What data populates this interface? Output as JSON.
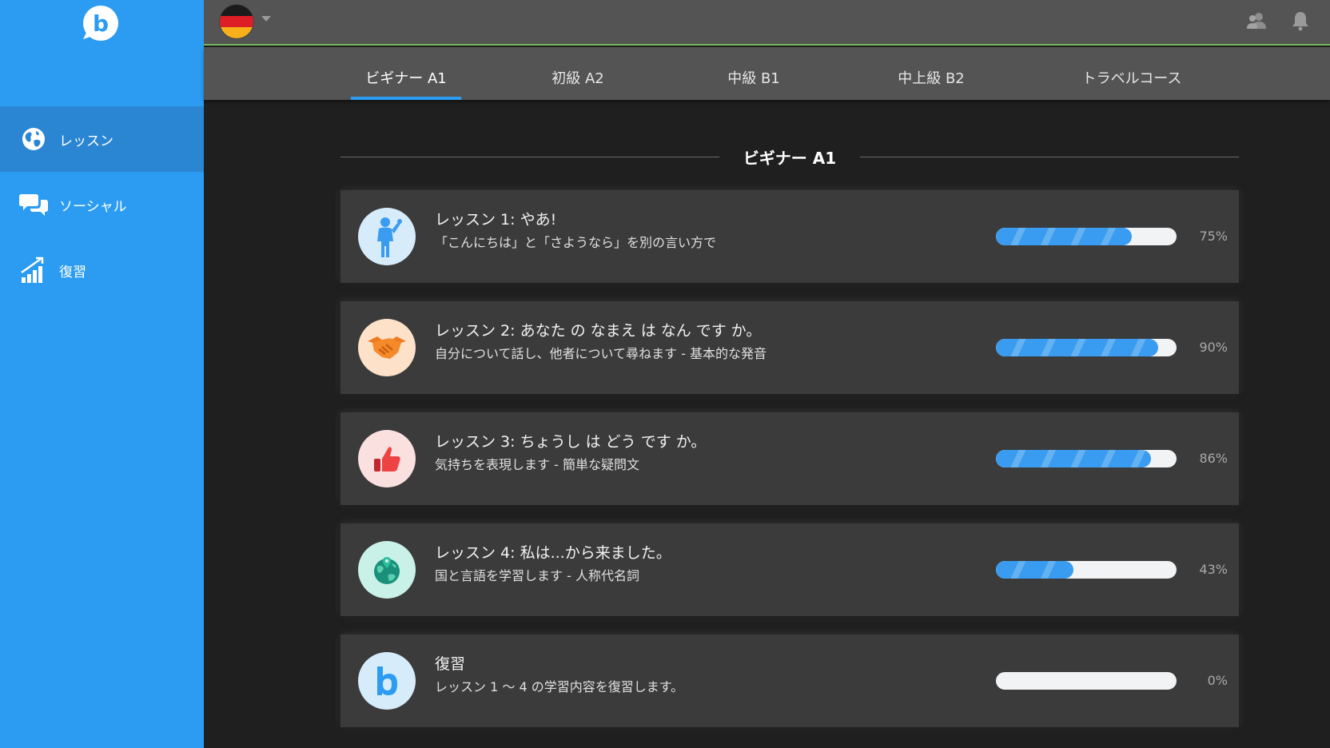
{
  "sidebar": {
    "logo_letter": "b",
    "items": [
      {
        "label": "レッスン",
        "icon": "globe-icon",
        "active": true
      },
      {
        "label": "ソーシャル",
        "icon": "chat-icon",
        "active": false
      },
      {
        "label": "復習",
        "icon": "chart-icon",
        "active": false
      }
    ]
  },
  "topbar": {
    "language_flag": "germany-flag-icon",
    "icons": [
      "friends-icon",
      "bell-icon"
    ]
  },
  "tabs": [
    {
      "label": "ビギナー A1",
      "active": true
    },
    {
      "label": "初級 A2",
      "active": false
    },
    {
      "label": "中級 B1",
      "active": false
    },
    {
      "label": "中上級 B2",
      "active": false
    },
    {
      "label": "トラベルコース",
      "active": false
    }
  ],
  "section": {
    "title": "ビギナー A1"
  },
  "lessons": [
    {
      "title": "レッスン 1: やあ!",
      "subtitle": "「こんにちは」と「さようなら」を別の言い方で",
      "progress": 75,
      "progress_label": "75%",
      "icon": "waving-person-icon",
      "icon_bg": "#d6ecfb"
    },
    {
      "title": "レッスン 2: あなた の なまえ は なん です か。",
      "subtitle": "自分について話し、他者について尋ねます - 基本的な発音",
      "progress": 90,
      "progress_label": "90%",
      "icon": "handshake-icon",
      "icon_bg": "#fde1c9"
    },
    {
      "title": "レッスン 3: ちょうし は どう です か。",
      "subtitle": "気持ちを表現します - 簡単な疑問文",
      "progress": 86,
      "progress_label": "86%",
      "icon": "thumbs-up-icon",
      "icon_bg": "#fbe0e0"
    },
    {
      "title": "レッスン 4: 私は...から来ました。",
      "subtitle": "国と言語を学習します - 人称代名詞",
      "progress": 43,
      "progress_label": "43%",
      "icon": "globe-pin-icon",
      "icon_bg": "#c9f1e7"
    },
    {
      "title": "復習",
      "subtitle": "レッスン 1 〜 4 の学習内容を復習します。",
      "progress": 0,
      "progress_label": "0%",
      "icon": "busuu-b-icon",
      "icon_bg": "#d6ecfb"
    }
  ],
  "colors": {
    "sidebar": "#2b9cf2",
    "sidebar_active": "#2a86d2",
    "topbar": "#545454",
    "background": "#1f1f1f",
    "card": "#3b3b3b",
    "progress_fill": "#3a9cf0",
    "topbar_accent": "#74b55a"
  }
}
